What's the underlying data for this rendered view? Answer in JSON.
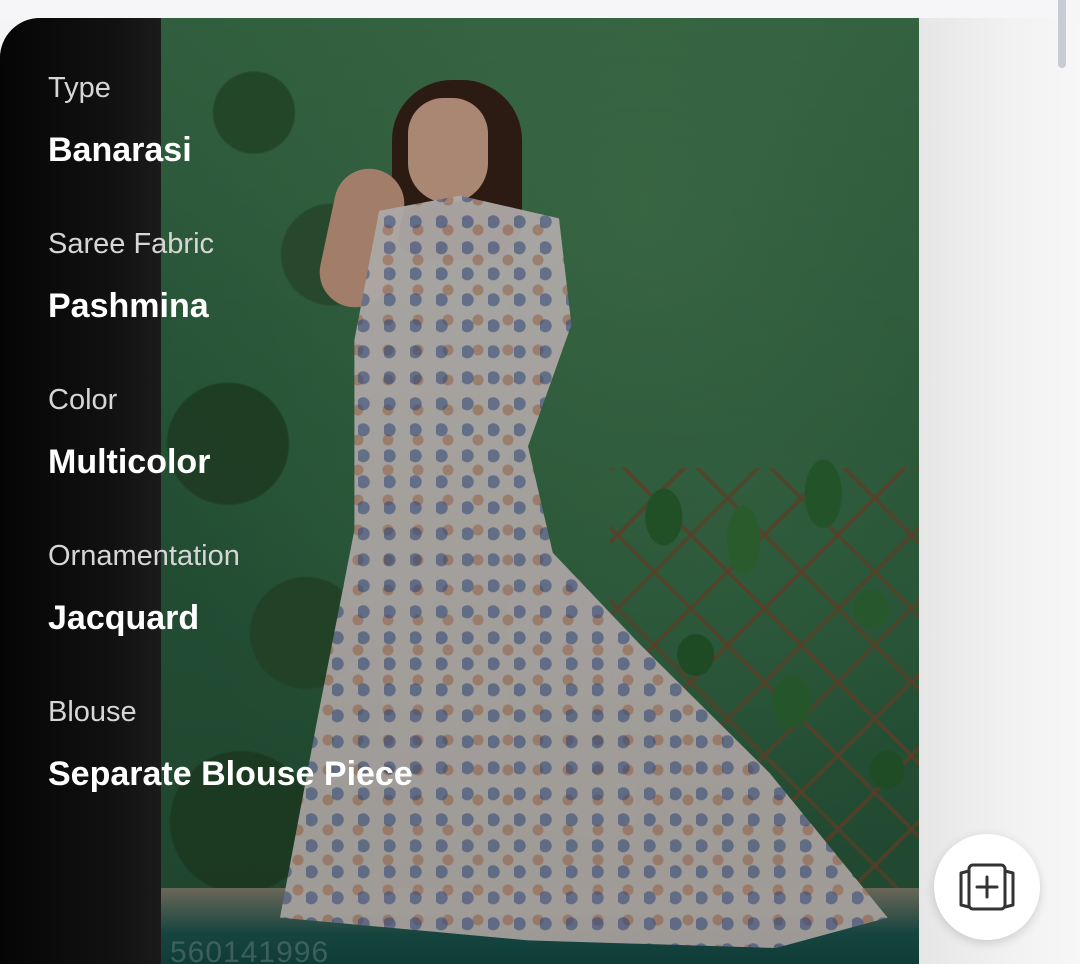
{
  "product": {
    "details": [
      {
        "label": "Type",
        "value": "Banarasi"
      },
      {
        "label": "Saree Fabric",
        "value": "Pashmina"
      },
      {
        "label": "Color",
        "value": "Multicolor"
      },
      {
        "label": "Ornamentation",
        "value": "Jacquard"
      },
      {
        "label": "Blouse",
        "value": "Separate Blouse Piece"
      }
    ],
    "image_watermark": "560141996"
  },
  "actions": {
    "add_to_compare_icon": "add-collection-icon"
  },
  "colors": {
    "overlay_text_label": "#d6d6d6",
    "overlay_text_value": "#ffffff",
    "fab_background": "#ffffff"
  }
}
